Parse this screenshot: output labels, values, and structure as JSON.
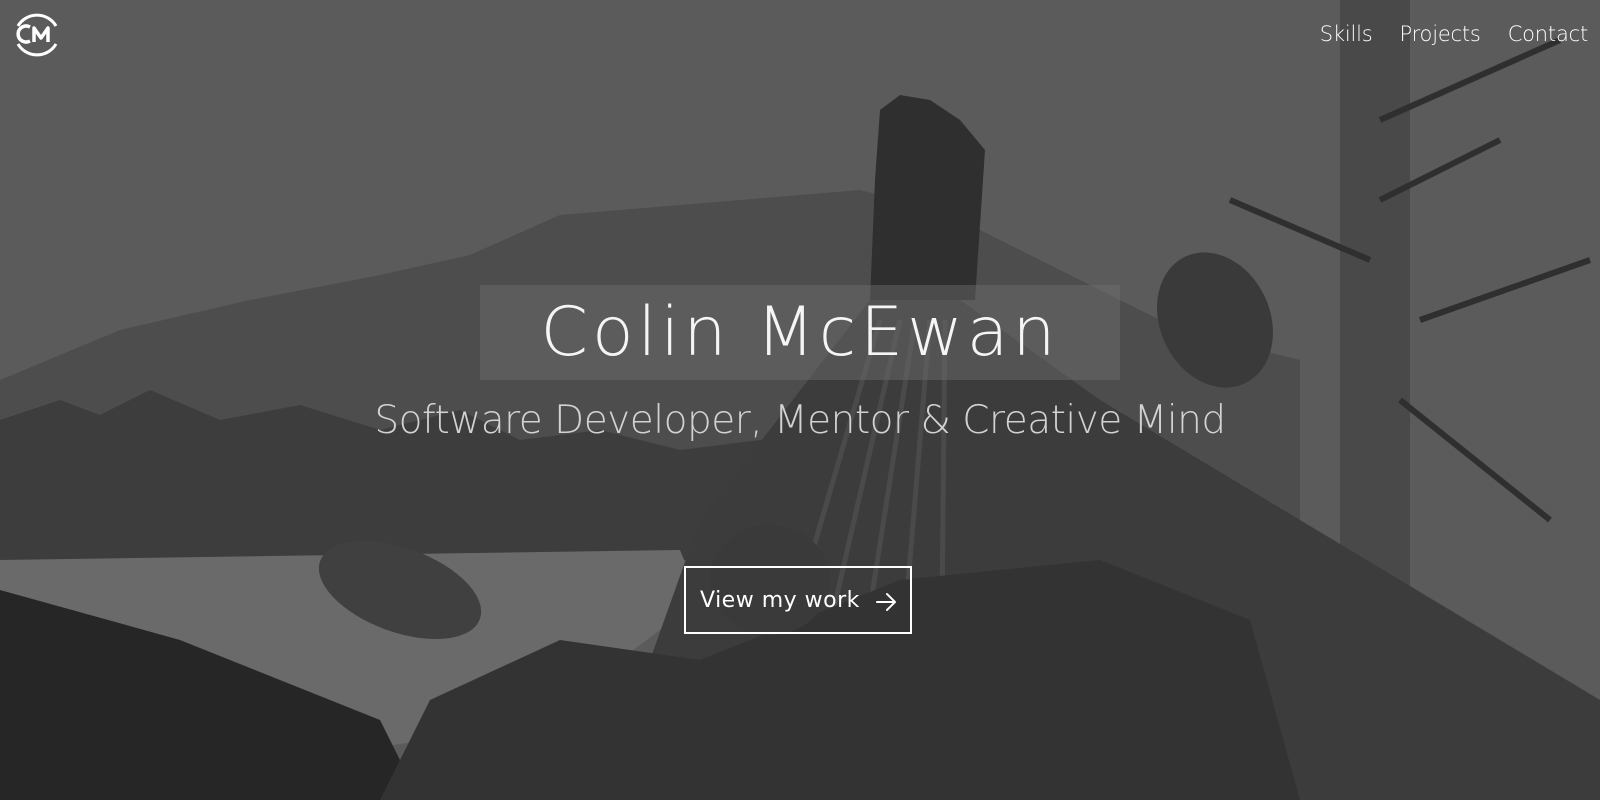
{
  "logo": {
    "icon": "cm-monogram-icon"
  },
  "nav": {
    "items": [
      {
        "label": "Skills"
      },
      {
        "label": "Projects"
      },
      {
        "label": "Contact"
      }
    ]
  },
  "hero": {
    "background_icon": "hammock-photo",
    "title": "Colin McEwan",
    "subtitle": "Software Developer, Mentor & Creative Mind",
    "cta": {
      "label": "View my work",
      "icon": "arrow-right-icon"
    }
  },
  "colors": {
    "text": "#ffffff",
    "subtitle": "#d2d2d2",
    "title_box": "#6e6e6e"
  }
}
